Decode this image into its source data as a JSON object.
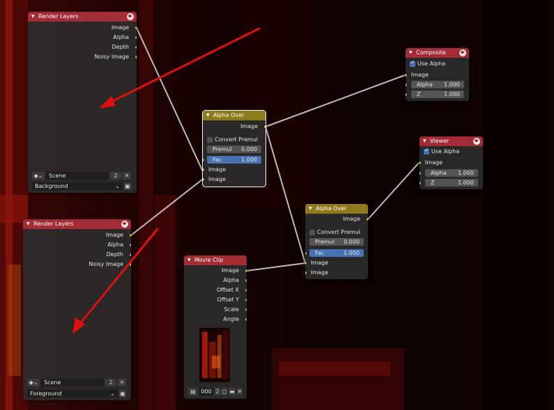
{
  "colors": {
    "node_header_red": "#a42c37",
    "node_header_gold": "#8d7a1a",
    "socket_yellow": "#c7c729",
    "socket_gray": "#a1a1a1",
    "field_blue": "#4772b3",
    "annotation_arrow": "#e01010"
  },
  "nodes": {
    "render_layers_1": {
      "title": "Render Layers",
      "outputs": [
        "Image",
        "Alpha",
        "Depth",
        "Noisy Image"
      ],
      "scene": "Scene",
      "users": "2",
      "layer": "Background"
    },
    "render_layers_2": {
      "title": "Render Layers",
      "outputs": [
        "Image",
        "Alpha",
        "Depth",
        "Noisy Image"
      ],
      "scene": "Scene",
      "users": "2",
      "layer": "Foreground"
    },
    "alpha_over_1": {
      "title": "Alpha Over",
      "output": "Image",
      "convert_premul": "Convert Premul",
      "premul_label": "Premul",
      "premul_value": "0.000",
      "fac_label": "Fac",
      "fac_value": "1.000",
      "inputs": [
        "Image",
        "Image"
      ]
    },
    "alpha_over_2": {
      "title": "Alpha Over",
      "output": "Image",
      "convert_premul": "Convert Premul",
      "premul_label": "Premul",
      "premul_value": "0.000",
      "fac_label": "Fac",
      "fac_value": "1.000",
      "inputs": [
        "Image",
        "Image"
      ]
    },
    "composite": {
      "title": "Composite",
      "use_alpha": "Use Alpha",
      "input": "Image",
      "alpha_label": "Alpha",
      "alpha_value": "1.000",
      "z_label": "Z",
      "z_value": "1.000"
    },
    "viewer": {
      "title": "Viewer",
      "use_alpha": "Use Alpha",
      "input": "Image",
      "alpha_label": "Alpha",
      "alpha_value": "1.000",
      "z_label": "Z",
      "z_value": "1.000"
    },
    "movie_clip": {
      "title": "Movie Clip",
      "outputs": [
        "Image",
        "Alpha",
        "Offset X",
        "Offset Y",
        "Scale",
        "Angle"
      ],
      "clip_name": "000",
      "users": "2"
    }
  }
}
